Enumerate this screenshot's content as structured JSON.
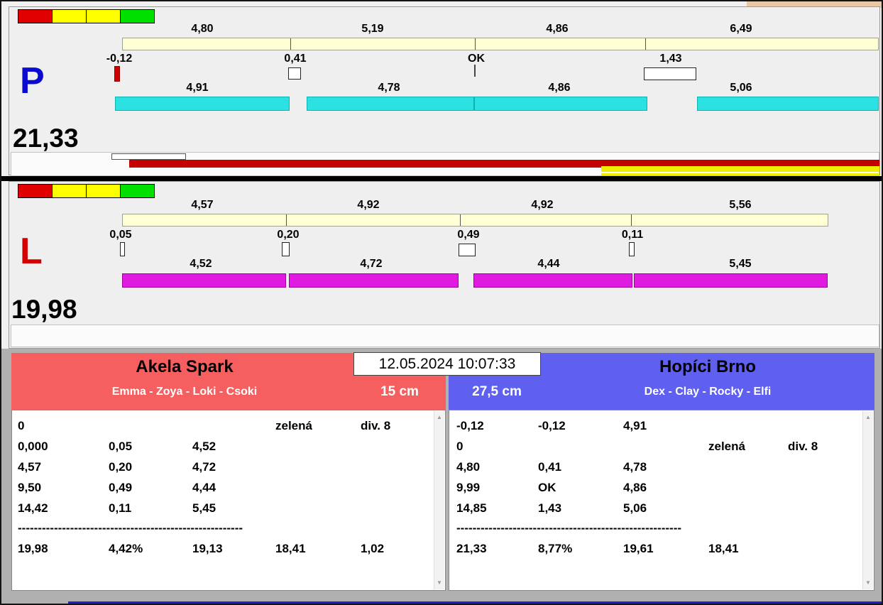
{
  "timestamp": "12.05.2024 10:07:33",
  "lane_p": {
    "label": "P",
    "total": "21,33",
    "splits_top": [
      "4,80",
      "5,19",
      "4,86",
      "6,49"
    ],
    "changes": [
      "-0,12",
      "0,41",
      "OK",
      "1,43"
    ],
    "splits_bottom": [
      "4,91",
      "4,78",
      "4,86",
      "5,06"
    ]
  },
  "lane_l": {
    "label": "L",
    "total": "19,98",
    "splits_top": [
      "4,57",
      "4,92",
      "4,92",
      "5,56"
    ],
    "changes": [
      "0,05",
      "0,20",
      "0,49",
      "0,11"
    ],
    "splits_bottom": [
      "4,52",
      "4,72",
      "4,44",
      "5,45"
    ]
  },
  "teams": {
    "left": {
      "name": "Akela Spark",
      "dogs": "Emma - Zoya - Loki - Csoki",
      "height": "15 cm",
      "rows": [
        [
          "0",
          "",
          "",
          "zelená",
          "div. 8"
        ],
        [
          "0,000",
          "0,05",
          "4,52",
          "",
          ""
        ],
        [
          "4,57",
          "0,20",
          "4,72",
          "",
          ""
        ],
        [
          "9,50",
          "0,49",
          "4,44",
          "",
          ""
        ],
        [
          "14,42",
          "0,11",
          "5,45",
          "",
          ""
        ]
      ],
      "separator": "--------------------------------------------------------",
      "totals": [
        "19,98",
        "4,42%",
        "19,13",
        "18,41",
        "1,02"
      ]
    },
    "right": {
      "name": "Hopíci Brno",
      "dogs": "Dex - Clay - Rocky - Elfi",
      "height": "27,5 cm",
      "rows": [
        [
          "-0,12",
          "-0,12",
          "4,91",
          "",
          ""
        ],
        [
          "0",
          "",
          "",
          "zelená",
          "div. 8"
        ],
        [
          "4,80",
          "0,41",
          "4,78",
          "",
          ""
        ],
        [
          "9,99",
          "OK",
          "4,86",
          "",
          ""
        ],
        [
          "14,85",
          "1,43",
          "5,06",
          "",
          ""
        ]
      ],
      "separator": "--------------------------------------------------------",
      "totals": [
        "21,33",
        "8,77%",
        "19,61",
        "18,41",
        ""
      ]
    }
  },
  "colors": {
    "indicator_segments": [
      "#e00000",
      "#ffff00",
      "#ffff00",
      "#00e000"
    ],
    "lane_p_letter": "#0a0ad0",
    "lane_l_letter": "#d40000",
    "lane_p_lap_bars": "#2ce1e1",
    "lane_l_lap_bars": "#e11ae1",
    "split_bar_fill": "#ffffd4",
    "progress_red": "#c40000",
    "progress_yellow": "#f0ee00",
    "team_left_header": "#f55f5f",
    "team_right_header": "#5f5ff0"
  }
}
